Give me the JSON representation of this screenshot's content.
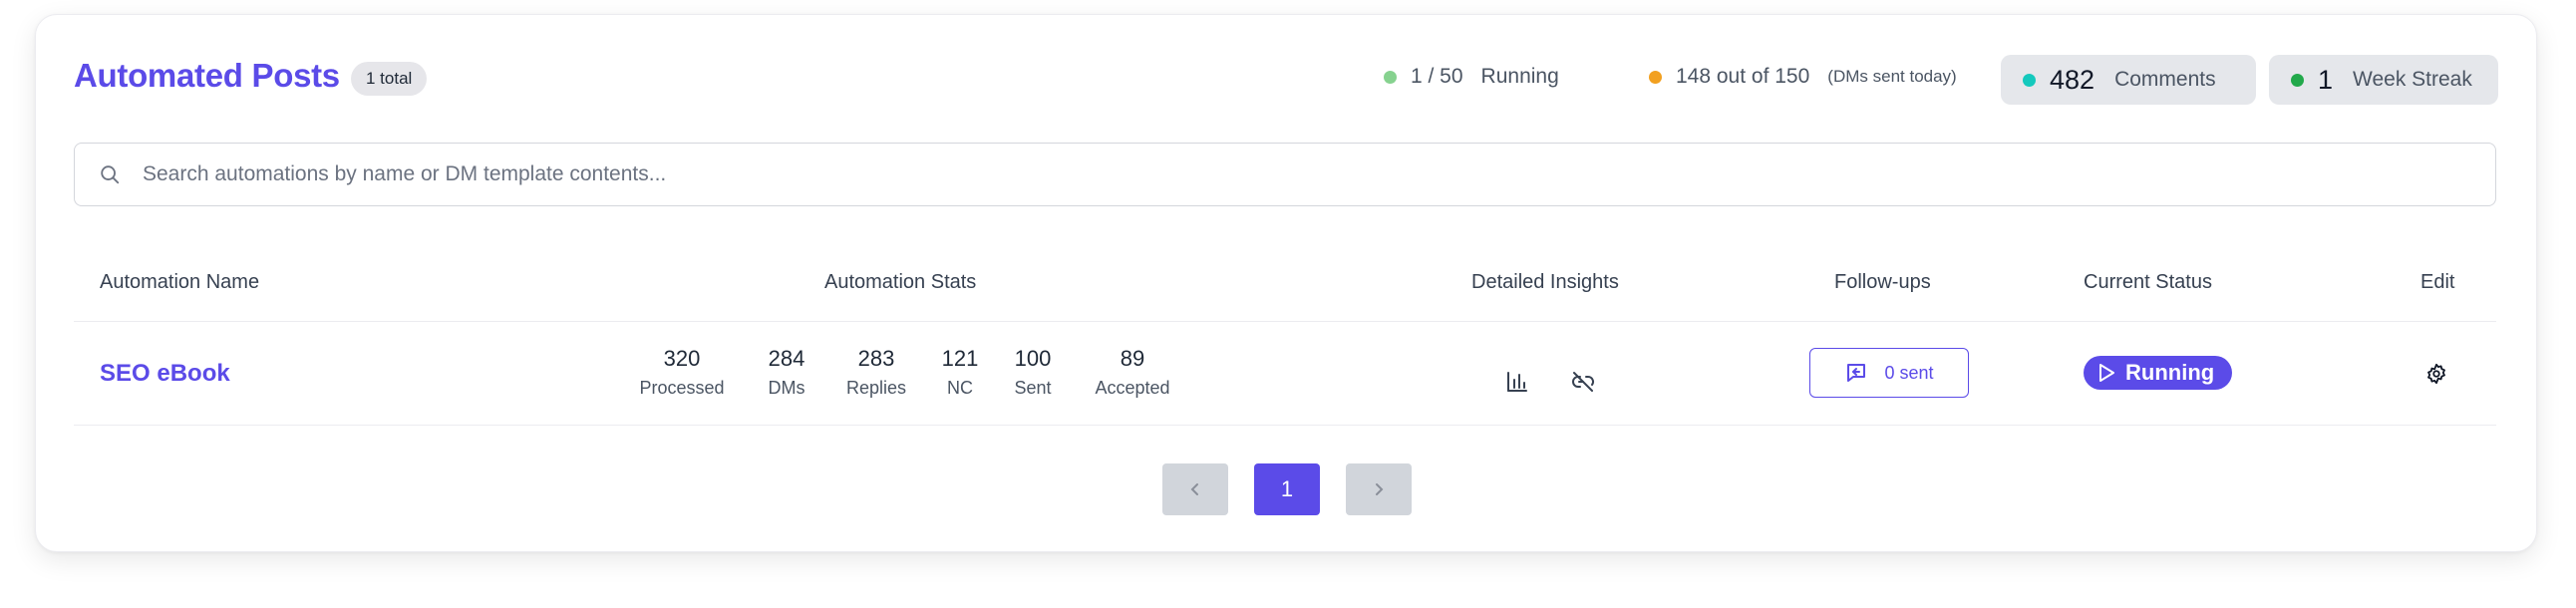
{
  "header": {
    "title": "Automated Posts",
    "total_badge": "1 total",
    "running_value": "1 / 50",
    "running_label": "Running",
    "dms_value": "148 out of 150",
    "dms_note": "(DMs sent today)",
    "comments_value": "482",
    "comments_label": "Comments",
    "streak_value": "1",
    "streak_label": "Week Streak"
  },
  "colors": {
    "accent": "#5b4be8",
    "running_dot": "#86d28f",
    "dms_dot": "#f2a020",
    "comments_dot": "#14c9bd",
    "streak_dot": "#22a94b"
  },
  "search": {
    "placeholder": "Search automations by name or DM template contents..."
  },
  "table": {
    "headers": {
      "name": "Automation Name",
      "stats": "Automation Stats",
      "insights": "Detailed Insights",
      "followups": "Follow-ups",
      "status": "Current Status",
      "edit": "Edit"
    },
    "rows": [
      {
        "name": "SEO eBook",
        "stats": [
          {
            "value": "320",
            "label": "Processed"
          },
          {
            "value": "284",
            "label": "DMs"
          },
          {
            "value": "283",
            "label": "Replies"
          },
          {
            "value": "121",
            "label": "NC"
          },
          {
            "value": "100",
            "label": "Sent"
          },
          {
            "value": "89",
            "label": "Accepted"
          }
        ],
        "insight_icons": [
          "bar-chart-icon",
          "unlink-icon"
        ],
        "followups": "0 sent",
        "status": "Running",
        "edit_icon": "gear-icon"
      }
    ]
  },
  "pagination": {
    "prev_icon": "chevron-left-icon",
    "current_page": "1",
    "next_icon": "chevron-right-icon"
  }
}
